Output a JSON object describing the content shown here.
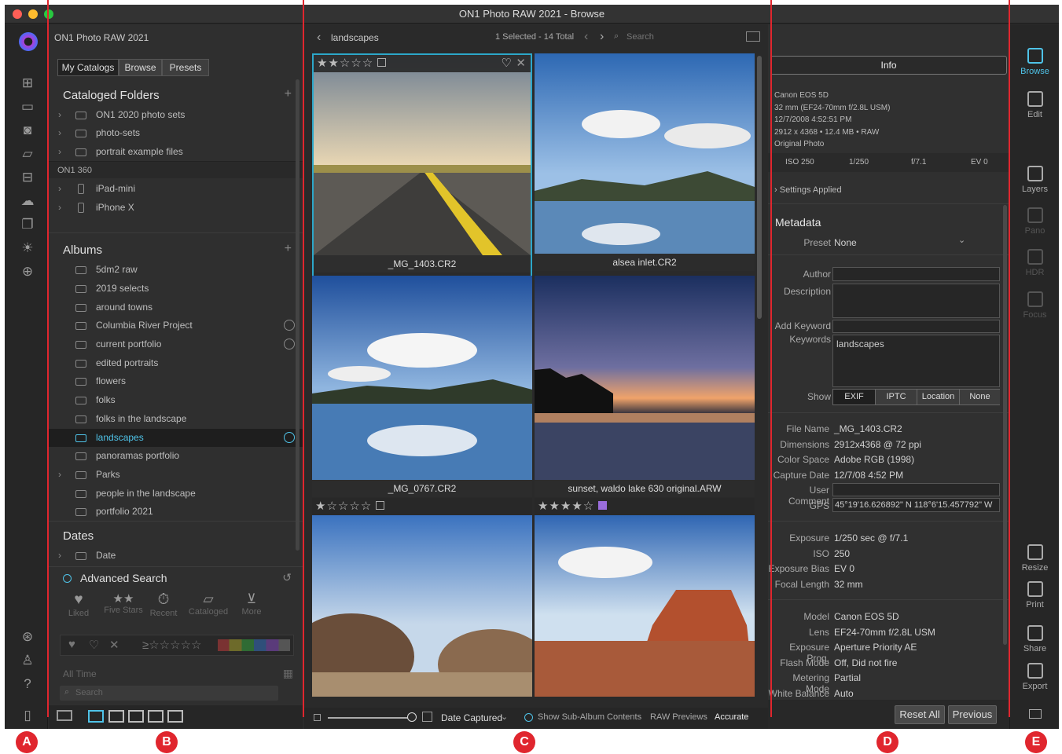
{
  "window": {
    "title": "ON1 Photo RAW 2021 - Browse"
  },
  "left": {
    "app_name": "ON1 Photo RAW 2021",
    "tabs": [
      "My Catalogs",
      "Browse",
      "Presets"
    ],
    "cataloged_title": "Cataloged Folders",
    "folders": [
      "ON1 2020 photo sets",
      "photo-sets",
      "portrait example files"
    ],
    "on1_360": "ON1 360",
    "devices": [
      "iPad-mini",
      "iPhone X"
    ],
    "albums_title": "Albums",
    "albums": [
      "5dm2 raw",
      "2019 selects",
      "around towns",
      "Columbia River Project",
      "current portfolio",
      "edited portraits",
      "flowers",
      "folks",
      "folks in the landscape",
      "landscapes",
      "panoramas portfolio",
      "Parks",
      "people in the landscape",
      "portfolio 2021"
    ],
    "dates_title": "Dates",
    "date_item": "Date",
    "adv_title": "Advanced Search",
    "adv_items": [
      "Liked",
      "Five Stars",
      "Recent",
      "Cataloged",
      "More"
    ],
    "all_time": "All Time",
    "search_placeholder": "Search"
  },
  "center": {
    "breadcrumb": "landscapes",
    "count": "1 Selected - 14 Total",
    "search_placeholder": "Search",
    "thumbs": [
      {
        "name": "_MG_1403.CR2",
        "stars": "★★☆☆☆"
      },
      {
        "name": "alsea inlet.CR2",
        "stars": ""
      },
      {
        "name": "_MG_0767.CR2",
        "stars": ""
      },
      {
        "name": "sunset, waldo lake 630 original.ARW",
        "stars": ""
      },
      {
        "name": "",
        "stars": "★☆☆☆☆"
      },
      {
        "name": "",
        "stars": "★★★★☆"
      }
    ],
    "sort": "Date Captured",
    "sub_album": "Show Sub-Album Contents",
    "raw_previews": "RAW Previews",
    "accurate": "Accurate"
  },
  "info": {
    "tab": "Info",
    "camera": "Canon EOS 5D",
    "lens_line": "32 mm (EF24-70mm f/2.8L USM)",
    "datetime": "12/7/2008 4:52:51 PM",
    "size_line": "2912 x 4368 • 12.4 MB • RAW",
    "original": "Original Photo",
    "iso": "ISO 250",
    "shutter": "1/250",
    "aperture": "f/7.1",
    "ev": "EV 0",
    "settings_applied": "Settings Applied",
    "metadata_title": "Metadata",
    "preset_label": "Preset",
    "preset_value": "None",
    "author_label": "Author",
    "description_label": "Description",
    "add_keyword_label": "Add Keyword",
    "keywords_label": "Keywords",
    "keywords_value": "landscapes",
    "show_label": "Show",
    "show_tabs": [
      "EXIF",
      "IPTC",
      "Location",
      "None"
    ],
    "fields1": [
      {
        "label": "File Name",
        "value": "_MG_1403.CR2"
      },
      {
        "label": "Dimensions",
        "value": "2912x4368 @ 72 ppi"
      },
      {
        "label": "Color Space",
        "value": "Adobe RGB (1998)"
      },
      {
        "label": "Capture Date",
        "value": "12/7/08 4:52 PM"
      },
      {
        "label": "User Comment",
        "value": ""
      },
      {
        "label": "GPS",
        "value": "45°19'16.626892\" N 118°6'15.457792\" W"
      }
    ],
    "fields2": [
      {
        "label": "Exposure",
        "value": "1/250 sec @ f/7.1"
      },
      {
        "label": "ISO",
        "value": "250"
      },
      {
        "label": "Exposure Bias",
        "value": "EV 0"
      },
      {
        "label": "Focal Length",
        "value": "32 mm"
      }
    ],
    "fields3": [
      {
        "label": "Model",
        "value": "Canon EOS 5D"
      },
      {
        "label": "Lens",
        "value": "EF24-70mm f/2.8L USM"
      },
      {
        "label": "Exposure Prog.",
        "value": "Aperture Priority AE"
      },
      {
        "label": "Flash Mode",
        "value": "Off, Did not fire"
      },
      {
        "label": "Metering Mode",
        "value": "Partial"
      },
      {
        "label": "White Balance",
        "value": "Auto"
      }
    ],
    "reset_all": "Reset All",
    "previous": "Previous"
  },
  "right": {
    "items": [
      "Browse",
      "Edit",
      "Layers",
      "Pano",
      "HDR",
      "Focus",
      "Resize",
      "Print",
      "Share",
      "Export"
    ]
  },
  "callouts": [
    "A",
    "B",
    "C",
    "D",
    "E"
  ]
}
